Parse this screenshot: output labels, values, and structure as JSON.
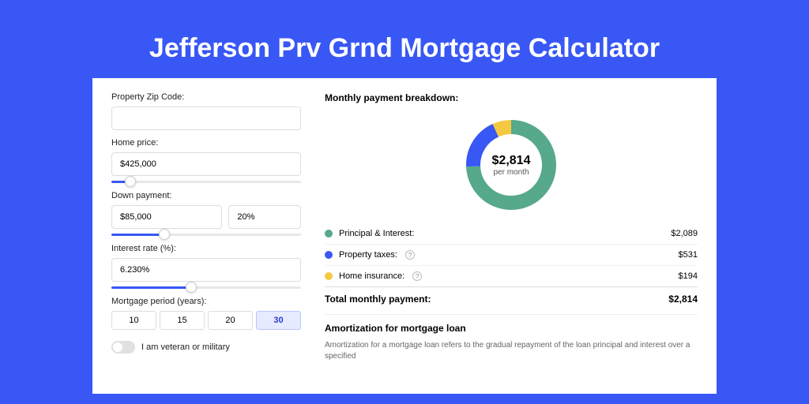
{
  "title": "Jefferson Prv Grnd Mortgage Calculator",
  "colors": {
    "principal": "#56a98a",
    "taxes": "#3857f5",
    "insurance": "#f5c842"
  },
  "form": {
    "zip_label": "Property Zip Code:",
    "zip_value": "",
    "home_price_label": "Home price:",
    "home_price_value": "$425,000",
    "home_price_slider_pct": 10,
    "down_payment_label": "Down payment:",
    "down_payment_value": "$85,000",
    "down_payment_pct": "20%",
    "down_payment_slider_pct": 28,
    "interest_label": "Interest rate (%):",
    "interest_value": "6.230%",
    "interest_slider_pct": 42,
    "period_label": "Mortgage period (years):",
    "periods": [
      "10",
      "15",
      "20",
      "30"
    ],
    "period_active": "30",
    "veteran_label": "I am veteran or military"
  },
  "breakdown": {
    "title": "Monthly payment breakdown:",
    "center_amount": "$2,814",
    "center_sub": "per month",
    "items": [
      {
        "label": "Principal & Interest:",
        "value": "$2,089",
        "color_key": "principal",
        "help": false
      },
      {
        "label": "Property taxes:",
        "value": "$531",
        "color_key": "taxes",
        "help": true
      },
      {
        "label": "Home insurance:",
        "value": "$194",
        "color_key": "insurance",
        "help": true
      }
    ],
    "total_label": "Total monthly payment:",
    "total_value": "$2,814"
  },
  "chart_data": {
    "type": "pie",
    "title": "Monthly payment breakdown",
    "series": [
      {
        "name": "Principal & Interest",
        "value": 2089
      },
      {
        "name": "Property taxes",
        "value": 531
      },
      {
        "name": "Home insurance",
        "value": 194
      }
    ],
    "total": 2814
  },
  "amort": {
    "title": "Amortization for mortgage loan",
    "text": "Amortization for a mortgage loan refers to the gradual repayment of the loan principal and interest over a specified"
  }
}
